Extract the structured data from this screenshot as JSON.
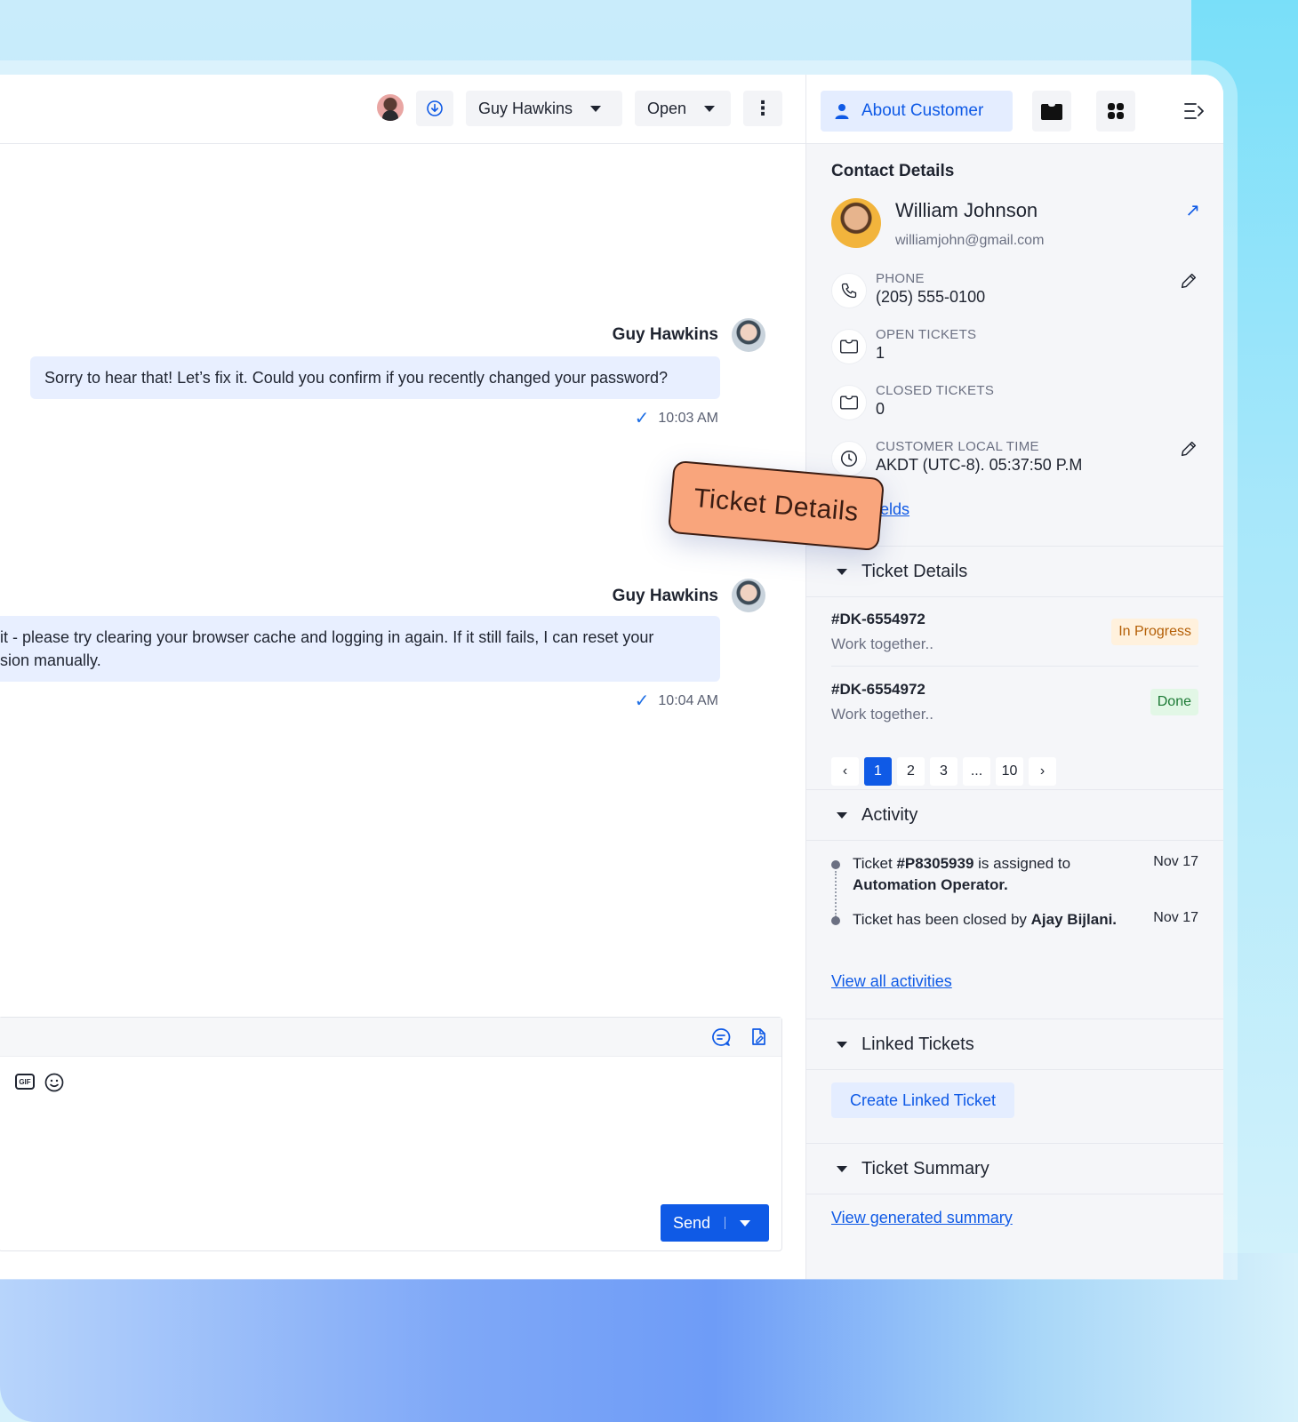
{
  "header": {
    "agent_name": "Guy Hawkins",
    "status": "Open",
    "more": "⋮"
  },
  "messages": [
    {
      "sender": "Guy Hawkins",
      "text": "Sorry to hear that! Let’s fix it. Could you confirm if you recently changed your password?",
      "time": "10:03 AM"
    },
    {
      "sender": "Guy Hawkins",
      "text_line1": "it - please try clearing your browser cache and logging in again. If it still fails, I can reset your",
      "text_line2": "sion manually.",
      "time": "10:04 AM"
    }
  ],
  "composer": {
    "send_label": "Send"
  },
  "panel": {
    "tab_about": "About Customer",
    "contact": {
      "section_title": "Contact Details",
      "name": "William Johnson",
      "email": "williamjohn@gmail.com",
      "phone_label": "PHONE",
      "phone_value": "(205) 555-0100",
      "open_tickets_label": "OPEN TICKETS",
      "open_tickets_value": "1",
      "closed_tickets_label": "CLOSED TICKETS",
      "closed_tickets_value": "0",
      "local_time_label": "CUSTOMER LOCAL TIME",
      "local_time_value": "AKDT (UTC-8). 05:37:50 P.M",
      "fields_link": "elds"
    },
    "ticket_details": {
      "title": "Ticket Details",
      "tickets": [
        {
          "id": "#DK-6554972",
          "subtitle": "Work together..",
          "status": "In Progress"
        },
        {
          "id": "#DK-6554972",
          "subtitle": "Work together..",
          "status": "Done"
        }
      ],
      "pager": {
        "prev": "‹",
        "pages": [
          "1",
          "2",
          "3",
          "...",
          "10"
        ],
        "next": "›",
        "current": "1"
      }
    },
    "activity": {
      "title": "Activity",
      "items": [
        {
          "prefix": "Ticket ",
          "bold": "#P8305939",
          "middle": " is assigned to ",
          "bold2": "Automation Operator.",
          "date": "Nov 17"
        },
        {
          "prefix": "Ticket has been closed by ",
          "bold": "Ajay Bijlani.",
          "date": "Nov 17"
        }
      ],
      "view_all": "View all activities"
    },
    "linked_tickets": {
      "title": "Linked Tickets",
      "button": "Create Linked Ticket"
    },
    "ticket_summary": {
      "title": "Ticket Summary",
      "link": "View generated summary"
    }
  },
  "sticker": {
    "label": "Ticket Details"
  },
  "colors": {
    "accent": "#0f5ae6",
    "bubble": "#e8efff",
    "panel_bg": "#f5f6f9",
    "sticker": "#f9a57c"
  }
}
